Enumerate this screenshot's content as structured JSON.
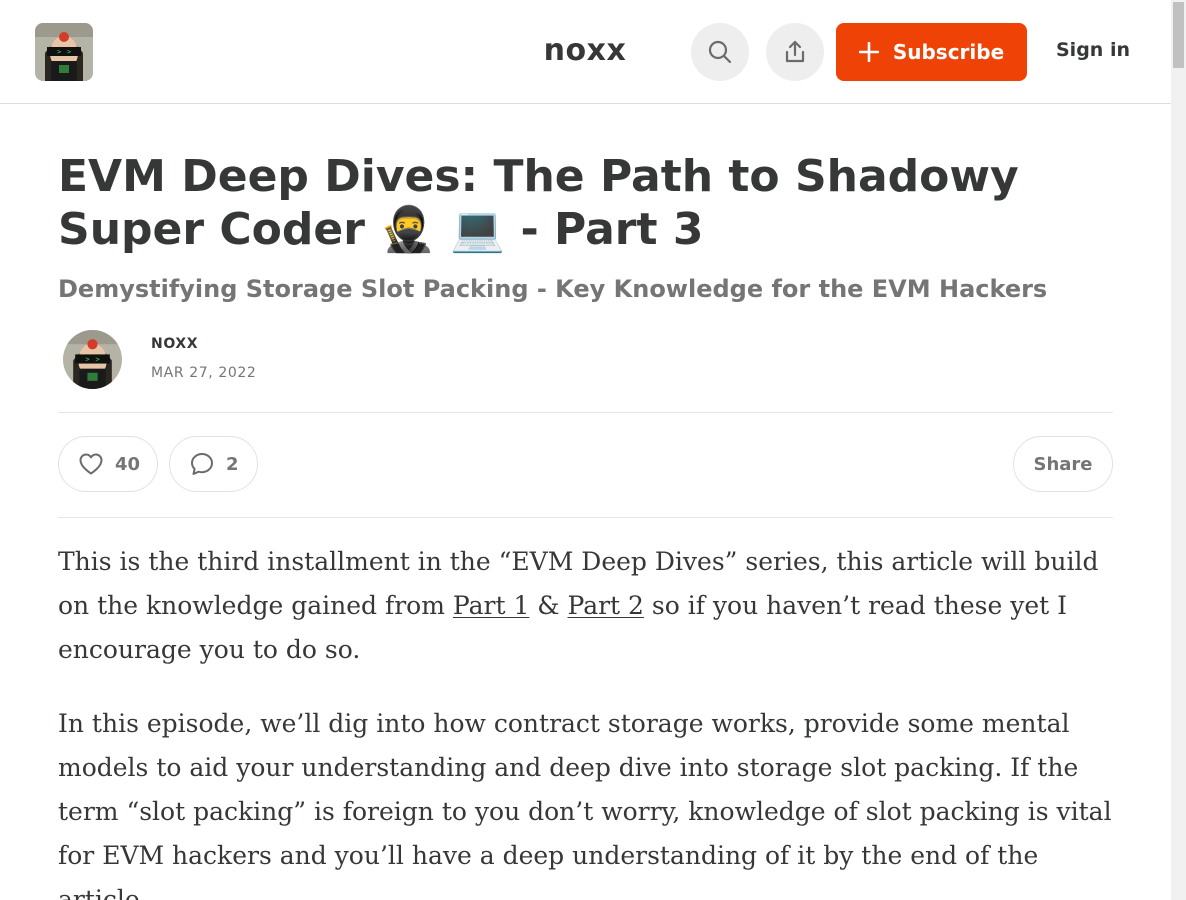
{
  "header": {
    "publication_name": "noxx",
    "subscribe_label": "Subscribe",
    "sign_in_label": "Sign in"
  },
  "post": {
    "title": "EVM Deep Dives: The Path to Shadowy Super Coder 🥷 💻 - Part 3",
    "subtitle": "Demystifying Storage Slot Packing - Key Knowledge for the EVM Hackers",
    "author": "NOXX",
    "date": "MAR 27, 2022"
  },
  "actions": {
    "like_count": "40",
    "comment_count": "2",
    "share_label": "Share"
  },
  "body": {
    "para1": {
      "before": "This is the third installment in the “EVM Deep Dives” series, this article will build on the knowledge gained from ",
      "link1": "Part 1",
      "middle": " & ",
      "link2": "Part 2",
      "after": " so if you haven’t read these yet I encourage you to do so."
    },
    "para2": "In this episode, we’ll dig into how contract storage works, provide some mental models to aid your understanding and deep dive into storage slot packing. If the term “slot packing” is foreign to you don’t worry, knowledge of slot packing is vital for EVM hackers and you’ll have a deep understanding of it by the end of the article."
  },
  "colors": {
    "accent": "#ee4206",
    "text": "#363737",
    "muted": "#757575"
  },
  "icons": {
    "search": "search-icon",
    "upload": "upload-share-icon",
    "plus": "plus-icon",
    "heart": "heart-icon",
    "comment": "comment-bubble-icon"
  }
}
